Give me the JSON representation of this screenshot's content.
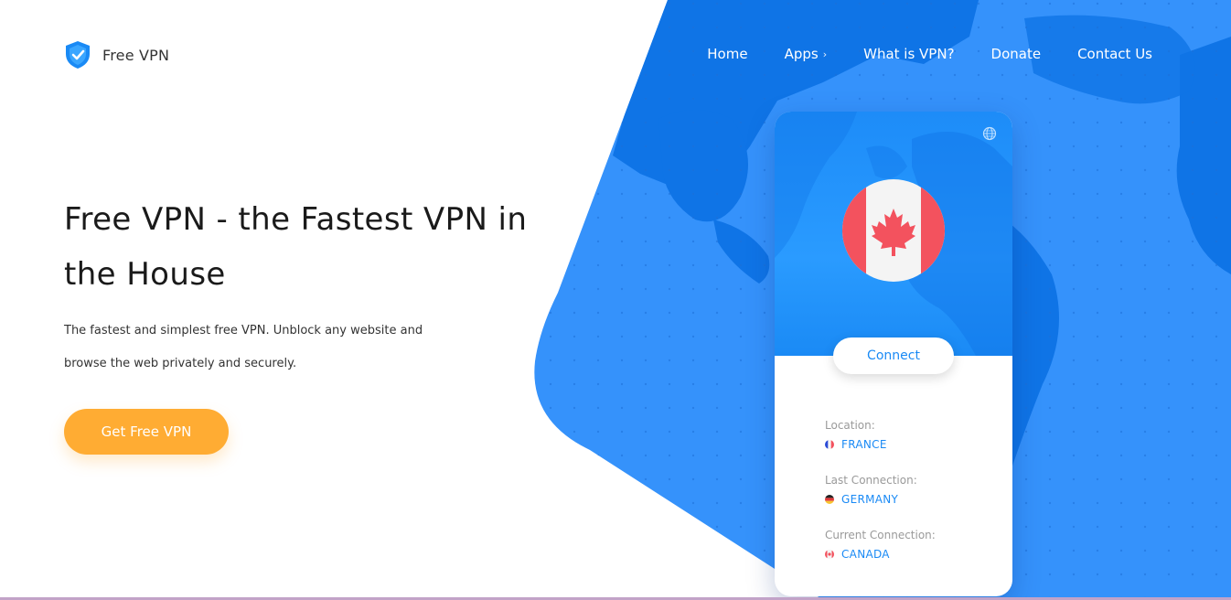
{
  "brand": {
    "name": "Free VPN",
    "icon": "shield-check-icon"
  },
  "nav": {
    "items": [
      {
        "label": "Home"
      },
      {
        "label": "Apps",
        "chevron": "›"
      },
      {
        "label": "What is VPN?"
      },
      {
        "label": "Donate"
      },
      {
        "label": "Contact Us"
      }
    ]
  },
  "hero": {
    "title": "Free VPN - the Fastest VPN in the House",
    "subtitle": "The fastest and simplest free VPN. Unblock any website and browse the web privately and securely.",
    "cta_label": "Get Free VPN"
  },
  "phone": {
    "globe_icon": "globe-icon",
    "flag_icon": "canada-flag-icon",
    "connect_label": "Connect",
    "location": {
      "label": "Location:",
      "value": "FRANCE",
      "flag": "france-flag-icon"
    },
    "last_connection": {
      "label": "Last Connection:",
      "value": "GERMANY",
      "flag": "germany-flag-icon"
    },
    "current_connection": {
      "label": "Current Connection:",
      "value": "CANADA",
      "flag": "canada-flag-icon"
    }
  },
  "colors": {
    "accent": "#1a8af5",
    "map_blue": "#3592fb",
    "land_blue": "#0f74e6",
    "cta": "#ffac33",
    "flag_red": "#f3525e"
  }
}
